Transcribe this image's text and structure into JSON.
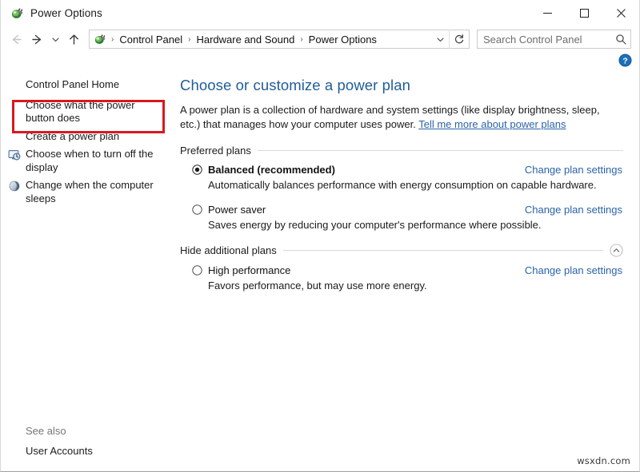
{
  "window": {
    "title": "Power Options",
    "icon": "power-plug-icon",
    "controls": {
      "minimize": "Minimize",
      "maximize": "Maximize",
      "close": "Close"
    }
  },
  "toolbar": {
    "back": "Back",
    "forward": "Forward",
    "recent": "Recent locations",
    "up": "Up",
    "breadcrumbs": [
      "Control Panel",
      "Hardware and Sound",
      "Power Options"
    ],
    "separator": "›",
    "dropdown": "Previous locations",
    "refresh": "Refresh",
    "search": {
      "placeholder": "Search Control Panel",
      "value": "",
      "icon": "search-icon"
    }
  },
  "help": {
    "label": "Help",
    "icon": "help-circle-icon"
  },
  "sidebar": {
    "items": [
      {
        "label": "Control Panel Home",
        "icon": null
      },
      {
        "label": "Choose what the power button does",
        "icon": null,
        "highlighted": true
      },
      {
        "label": "Create a power plan",
        "icon": null
      },
      {
        "label": "Choose when to turn off the display",
        "icon": "display-clock-icon"
      },
      {
        "label": "Change when the computer sleeps",
        "icon": "moon-sleep-icon"
      }
    ],
    "see_also": {
      "title": "See also",
      "links": [
        "User Accounts"
      ]
    }
  },
  "main": {
    "title": "Choose or customize a power plan",
    "intro_text": "A power plan is a collection of hardware and system settings (like display brightness, sleep, etc.) that manages how your computer uses power.",
    "intro_link": "Tell me more about power plans",
    "groups": [
      {
        "label": "Preferred plans",
        "toggle": null,
        "plans": [
          {
            "name": "Balanced (recommended)",
            "selected": true,
            "bold": true,
            "description": "Automatically balances performance with energy consumption on capable hardware.",
            "link": "Change plan settings"
          },
          {
            "name": "Power saver",
            "selected": false,
            "bold": false,
            "description": "Saves energy by reducing your computer's performance where possible.",
            "link": "Change plan settings"
          }
        ]
      },
      {
        "label": "Hide additional plans",
        "toggle": "chevron-up-circle-icon",
        "plans": [
          {
            "name": "High performance",
            "selected": false,
            "bold": false,
            "description": "Favors performance, but may use more energy.",
            "link": "Change plan settings"
          }
        ]
      }
    ]
  },
  "watermark": "wsxdn.com",
  "colors": {
    "title_blue": "#1f5c99",
    "link_blue": "#2a63a8",
    "highlight_red": "#d71920",
    "help_blue": "#1c6fba"
  }
}
